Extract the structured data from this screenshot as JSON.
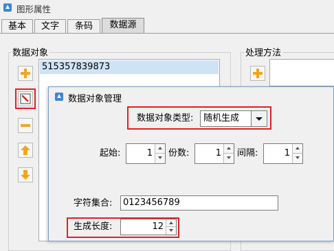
{
  "window": {
    "title": "图形属性"
  },
  "tabs": [
    {
      "label": "基本"
    },
    {
      "label": "文字"
    },
    {
      "label": "条码"
    },
    {
      "label": "数据源"
    }
  ],
  "data_object_group": {
    "label": "数据对象",
    "items": [
      "515357839873"
    ]
  },
  "processing_group": {
    "label": "处理方法"
  },
  "dialog": {
    "title": "数据对象管理",
    "type_label": "数据对象类型:",
    "type_value": "随机生成",
    "start_label": "起始:",
    "start_value": "1",
    "digits_label": "份数:",
    "digits_value": "1",
    "interval_label": "间隔:",
    "interval_value": "1",
    "charset_label": "字符集合:",
    "charset_value": "0123456789",
    "length_label": "生成长度:",
    "length_value": "12"
  },
  "colors": {
    "highlight_border": "#e02020",
    "selected_row": "#cfe3f7",
    "icon_orange": "#f2a51c"
  }
}
